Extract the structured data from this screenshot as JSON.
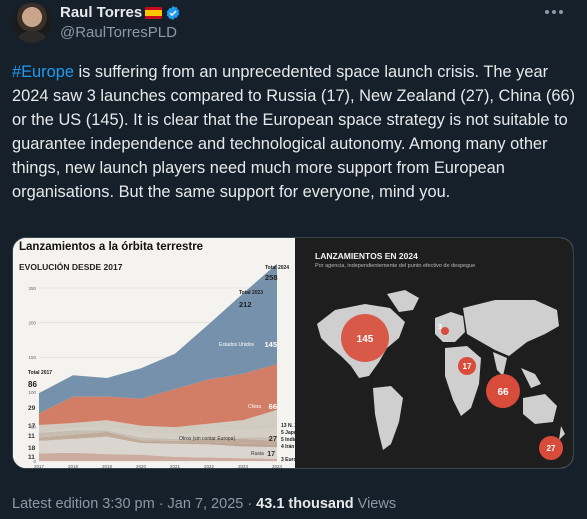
{
  "author": {
    "name": "Raul Torres",
    "handle": "@RaulTorresPLD"
  },
  "tweet": {
    "hashtag": "#Europe",
    "text": " is suffering from an unprecedented space launch crisis. The year 2024 saw 3 launches compared to Russia (17), New Zealand (27), China (66) or the US (145). It is clear that the European space strategy is not suitable to guarantee independence and technological autonomy. Among many other things, new launch players need much more support from European organisations. But the same support for everyone, mind you."
  },
  "media": {
    "left_title": "Lanzamientos a la órbita terrestre",
    "left_subtitle": "EVOLUCIÓN DESDE 2017",
    "right_title": "LANZAMIENTOS EN 2024",
    "right_subtitle": "Por agencia, independientemente del punto efectivo de despegue"
  },
  "chart_data": [
    {
      "type": "area",
      "title": "Lanzamientos a la órbita terrestre",
      "subtitle": "EVOLUCIÓN DESDE 2017",
      "x": [
        2017,
        2018,
        2019,
        2020,
        2021,
        2022,
        2023,
        2024
      ],
      "ylim": [
        0,
        250
      ],
      "yticks": [
        0,
        50,
        100,
        150,
        200,
        250
      ],
      "series": [
        {
          "name": "Europa",
          "values": [
            11,
            12,
            10,
            9,
            6,
            5,
            4,
            3
          ],
          "color": "#c9a89a"
        },
        {
          "name": "Rusia",
          "values": [
            18,
            20,
            25,
            17,
            19,
            19,
            17,
            17
          ],
          "color": "#d8d4cc"
        },
        {
          "name": "Irán",
          "values": [
            1,
            1,
            1,
            2,
            2,
            3,
            4,
            4
          ],
          "color": "#b7a090"
        },
        {
          "name": "India",
          "values": [
            4,
            5,
            6,
            2,
            2,
            5,
            7,
            5
          ],
          "color": "#bda594"
        },
        {
          "name": "Japón",
          "values": [
            7,
            6,
            2,
            4,
            3,
            0,
            2,
            5
          ],
          "color": "#c2b9ad"
        },
        {
          "name": "N. Zelanda",
          "values": [
            0,
            3,
            6,
            7,
            6,
            9,
            10,
            13
          ],
          "color": "#d2cbc2"
        },
        {
          "name": "Otros (sin contar Europa)",
          "values": [
            11,
            8,
            9,
            10,
            11,
            13,
            15,
            27
          ],
          "color": "#cfc8bd"
        },
        {
          "name": "China",
          "values": [
            17,
            38,
            34,
            39,
            55,
            64,
            67,
            66
          ],
          "color": "#d0765e"
        },
        {
          "name": "Estados Unidos",
          "values": [
            29,
            31,
            27,
            44,
            51,
            80,
            116,
            145
          ],
          "color": "#6f8ba6"
        }
      ],
      "totals": {
        "2017": 86,
        "2023": 212,
        "2024": 258
      },
      "total_labels": {
        "t2017": "Total 2017",
        "t2023": "Total 2023",
        "t2024": "Total 2024"
      },
      "left_labels": [
        "29",
        "17",
        "11",
        "18",
        "11"
      ],
      "right_labels": [
        {
          "value": "145",
          "name": "Estados Unidos"
        },
        {
          "value": "66",
          "name": "China"
        },
        {
          "value": "27",
          "name": "Otros (sin contar Europa)"
        },
        {
          "value": "13",
          "name": "N. Zelanda"
        },
        {
          "value": "5",
          "name": "Japón"
        },
        {
          "value": "5",
          "name": "India"
        },
        {
          "value": "4",
          "name": "Irán"
        },
        {
          "value": "17",
          "name": "Rusia"
        },
        {
          "value": "3",
          "name": "Europa"
        }
      ]
    },
    {
      "type": "map-bubble",
      "title": "LANZAMIENTOS EN 2024",
      "subtitle": "Por agencia, independientemente del punto efectivo de despegue",
      "bubbles": [
        {
          "label": "145",
          "region": "United States",
          "value": 145
        },
        {
          "label": "3",
          "region": "Europe",
          "value": 3
        },
        {
          "label": "17",
          "region": "Russia",
          "value": 17
        },
        {
          "label": "66",
          "region": "China",
          "value": 66
        },
        {
          "label": "27",
          "region": "New Zealand",
          "value": 27
        }
      ],
      "colors": {
        "bubble": "#d94b3a",
        "land": "#cfcfcf",
        "background": "#1e1e1e"
      }
    }
  ],
  "footer": {
    "time": "Latest edition 3:30 pm",
    "sep1": "·",
    "date": "Jan 7, 2025",
    "sep2": "·",
    "views_count": "43.1 thousand",
    "views_label": "Views"
  },
  "colors": {
    "background": "#15202b",
    "link": "#1d9bf0",
    "secondary": "#8b98a5"
  }
}
